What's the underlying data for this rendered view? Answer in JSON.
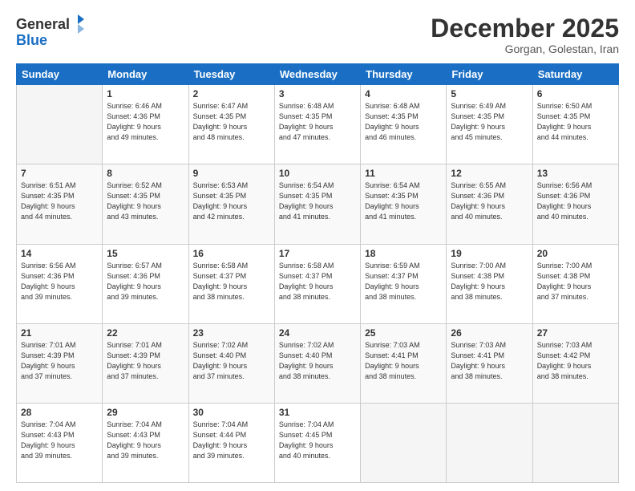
{
  "header": {
    "logo_line1": "General",
    "logo_line2": "Blue",
    "month_title": "December 2025",
    "location": "Gorgan, Golestan, Iran"
  },
  "weekdays": [
    "Sunday",
    "Monday",
    "Tuesday",
    "Wednesday",
    "Thursday",
    "Friday",
    "Saturday"
  ],
  "weeks": [
    [
      {
        "day": "",
        "sunrise": "",
        "sunset": "",
        "daylight": ""
      },
      {
        "day": "1",
        "sunrise": "6:46 AM",
        "sunset": "4:36 PM",
        "daylight": "9 hours and 49 minutes."
      },
      {
        "day": "2",
        "sunrise": "6:47 AM",
        "sunset": "4:35 PM",
        "daylight": "9 hours and 48 minutes."
      },
      {
        "day": "3",
        "sunrise": "6:48 AM",
        "sunset": "4:35 PM",
        "daylight": "9 hours and 47 minutes."
      },
      {
        "day": "4",
        "sunrise": "6:48 AM",
        "sunset": "4:35 PM",
        "daylight": "9 hours and 46 minutes."
      },
      {
        "day": "5",
        "sunrise": "6:49 AM",
        "sunset": "4:35 PM",
        "daylight": "9 hours and 45 minutes."
      },
      {
        "day": "6",
        "sunrise": "6:50 AM",
        "sunset": "4:35 PM",
        "daylight": "9 hours and 44 minutes."
      }
    ],
    [
      {
        "day": "7",
        "sunrise": "6:51 AM",
        "sunset": "4:35 PM",
        "daylight": "9 hours and 44 minutes."
      },
      {
        "day": "8",
        "sunrise": "6:52 AM",
        "sunset": "4:35 PM",
        "daylight": "9 hours and 43 minutes."
      },
      {
        "day": "9",
        "sunrise": "6:53 AM",
        "sunset": "4:35 PM",
        "daylight": "9 hours and 42 minutes."
      },
      {
        "day": "10",
        "sunrise": "6:54 AM",
        "sunset": "4:35 PM",
        "daylight": "9 hours and 41 minutes."
      },
      {
        "day": "11",
        "sunrise": "6:54 AM",
        "sunset": "4:35 PM",
        "daylight": "9 hours and 41 minutes."
      },
      {
        "day": "12",
        "sunrise": "6:55 AM",
        "sunset": "4:36 PM",
        "daylight": "9 hours and 40 minutes."
      },
      {
        "day": "13",
        "sunrise": "6:56 AM",
        "sunset": "4:36 PM",
        "daylight": "9 hours and 40 minutes."
      }
    ],
    [
      {
        "day": "14",
        "sunrise": "6:56 AM",
        "sunset": "4:36 PM",
        "daylight": "9 hours and 39 minutes."
      },
      {
        "day": "15",
        "sunrise": "6:57 AM",
        "sunset": "4:36 PM",
        "daylight": "9 hours and 39 minutes."
      },
      {
        "day": "16",
        "sunrise": "6:58 AM",
        "sunset": "4:37 PM",
        "daylight": "9 hours and 38 minutes."
      },
      {
        "day": "17",
        "sunrise": "6:58 AM",
        "sunset": "4:37 PM",
        "daylight": "9 hours and 38 minutes."
      },
      {
        "day": "18",
        "sunrise": "6:59 AM",
        "sunset": "4:37 PM",
        "daylight": "9 hours and 38 minutes."
      },
      {
        "day": "19",
        "sunrise": "7:00 AM",
        "sunset": "4:38 PM",
        "daylight": "9 hours and 38 minutes."
      },
      {
        "day": "20",
        "sunrise": "7:00 AM",
        "sunset": "4:38 PM",
        "daylight": "9 hours and 37 minutes."
      }
    ],
    [
      {
        "day": "21",
        "sunrise": "7:01 AM",
        "sunset": "4:39 PM",
        "daylight": "9 hours and 37 minutes."
      },
      {
        "day": "22",
        "sunrise": "7:01 AM",
        "sunset": "4:39 PM",
        "daylight": "9 hours and 37 minutes."
      },
      {
        "day": "23",
        "sunrise": "7:02 AM",
        "sunset": "4:40 PM",
        "daylight": "9 hours and 37 minutes."
      },
      {
        "day": "24",
        "sunrise": "7:02 AM",
        "sunset": "4:40 PM",
        "daylight": "9 hours and 38 minutes."
      },
      {
        "day": "25",
        "sunrise": "7:03 AM",
        "sunset": "4:41 PM",
        "daylight": "9 hours and 38 minutes."
      },
      {
        "day": "26",
        "sunrise": "7:03 AM",
        "sunset": "4:41 PM",
        "daylight": "9 hours and 38 minutes."
      },
      {
        "day": "27",
        "sunrise": "7:03 AM",
        "sunset": "4:42 PM",
        "daylight": "9 hours and 38 minutes."
      }
    ],
    [
      {
        "day": "28",
        "sunrise": "7:04 AM",
        "sunset": "4:43 PM",
        "daylight": "9 hours and 39 minutes."
      },
      {
        "day": "29",
        "sunrise": "7:04 AM",
        "sunset": "4:43 PM",
        "daylight": "9 hours and 39 minutes."
      },
      {
        "day": "30",
        "sunrise": "7:04 AM",
        "sunset": "4:44 PM",
        "daylight": "9 hours and 39 minutes."
      },
      {
        "day": "31",
        "sunrise": "7:04 AM",
        "sunset": "4:45 PM",
        "daylight": "9 hours and 40 minutes."
      },
      {
        "day": "",
        "sunrise": "",
        "sunset": "",
        "daylight": ""
      },
      {
        "day": "",
        "sunrise": "",
        "sunset": "",
        "daylight": ""
      },
      {
        "day": "",
        "sunrise": "",
        "sunset": "",
        "daylight": ""
      }
    ]
  ],
  "labels": {
    "sunrise": "Sunrise:",
    "sunset": "Sunset:",
    "daylight": "Daylight:"
  }
}
